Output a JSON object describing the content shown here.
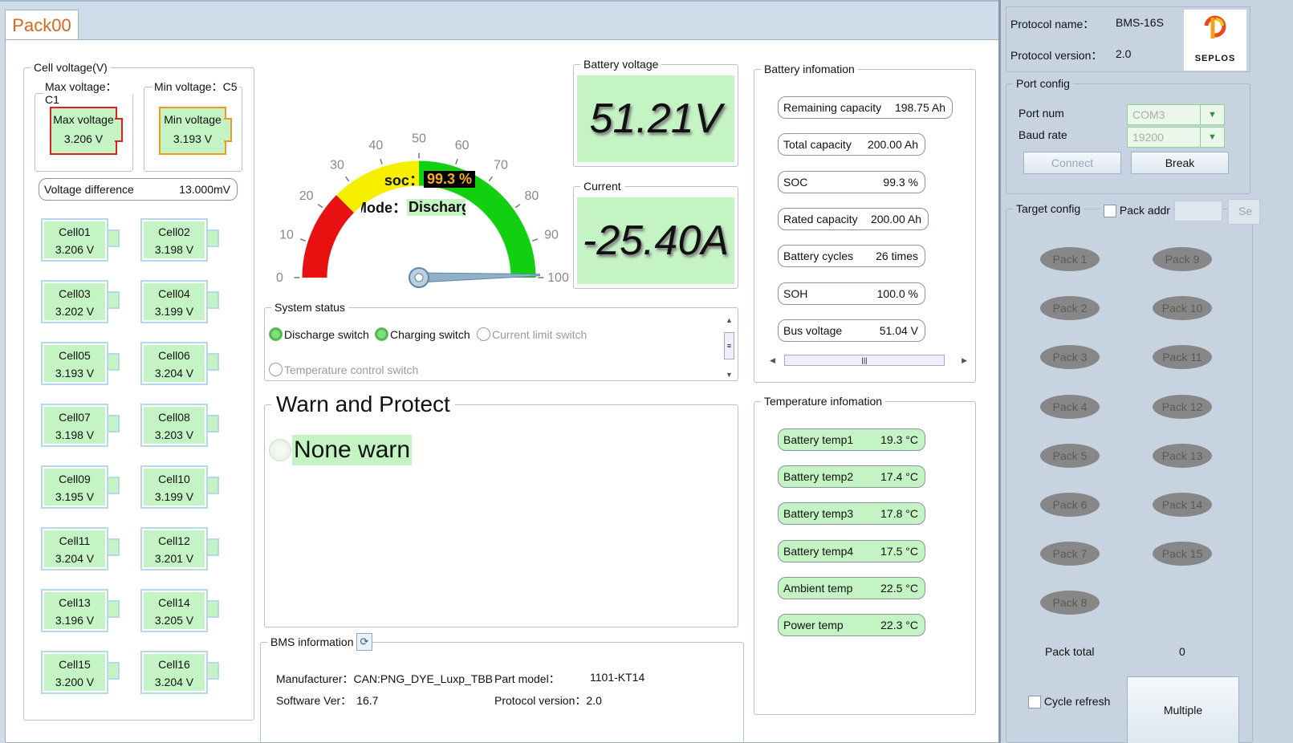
{
  "tab": {
    "label": "Pack00"
  },
  "cell_voltage": {
    "title": "Cell voltage(V)",
    "max_title": "Max voltage：C1",
    "min_title": "Min voltage：C5",
    "max_label": "Max voltage",
    "max_value": "3.206 V",
    "min_label": "Min voltage",
    "min_value": "3.193 V",
    "diff_label": "Voltage difference",
    "diff_value": "13.000mV",
    "cells": [
      {
        "name": "Cell01",
        "value": "3.206 V"
      },
      {
        "name": "Cell02",
        "value": "3.198 V"
      },
      {
        "name": "Cell03",
        "value": "3.202 V"
      },
      {
        "name": "Cell04",
        "value": "3.199 V"
      },
      {
        "name": "Cell05",
        "value": "3.193 V"
      },
      {
        "name": "Cell06",
        "value": "3.204 V"
      },
      {
        "name": "Cell07",
        "value": "3.198 V"
      },
      {
        "name": "Cell08",
        "value": "3.203 V"
      },
      {
        "name": "Cell09",
        "value": "3.195 V"
      },
      {
        "name": "Cell10",
        "value": "3.199 V"
      },
      {
        "name": "Cell11",
        "value": "3.204 V"
      },
      {
        "name": "Cell12",
        "value": "3.201 V"
      },
      {
        "name": "Cell13",
        "value": "3.196 V"
      },
      {
        "name": "Cell14",
        "value": "3.205 V"
      },
      {
        "name": "Cell15",
        "value": "3.200 V"
      },
      {
        "name": "Cell16",
        "value": "3.204 V"
      }
    ]
  },
  "gauge": {
    "ticks": [
      "0",
      "10",
      "20",
      "30",
      "40",
      "50",
      "60",
      "70",
      "80",
      "90",
      "100"
    ],
    "soc_label": "soc：",
    "soc_value": "99.3 %",
    "soc_fraction": 0.993,
    "mode_label": "Mode：",
    "mode_value": "Discharge",
    "colors": {
      "red": "#e81010",
      "yellow": "#f6f000",
      "green": "#10d010"
    }
  },
  "battery_voltage": {
    "title": "Battery voltage",
    "value": "51.21V"
  },
  "current": {
    "title": "Current",
    "value": "-25.40A"
  },
  "system_status": {
    "title": "System status",
    "items": [
      {
        "label": "Discharge switch",
        "on": true
      },
      {
        "label": "Charging switch",
        "on": true
      },
      {
        "label": "Current limit switch",
        "on": false
      },
      {
        "label": "Temperature control switch",
        "on": false
      }
    ]
  },
  "warn": {
    "title": "Warn and Protect",
    "status": "None warn"
  },
  "bms_info": {
    "title": "BMS information",
    "manufacturer_label": "Manufacturer：",
    "manufacturer": "CAN:PNG_DYE_Luxp_TBB",
    "model_label": "Part model：",
    "model": "1101-KT14",
    "software_label": "Software Ver：",
    "software": "16.7",
    "protocol_label": "Protocol version：",
    "protocol": "2.0"
  },
  "battery_info": {
    "title": "Battery infomation",
    "rows": [
      {
        "label": "Remaining capacity",
        "value": "198.75 Ah"
      },
      {
        "label": "Total capacity",
        "value": "200.00 Ah"
      },
      {
        "label": "SOC",
        "value": "99.3 %"
      },
      {
        "label": "Rated capacity",
        "value": "200.00 Ah"
      },
      {
        "label": "Battery cycles",
        "value": "26 times"
      },
      {
        "label": "SOH",
        "value": "100.0 %"
      },
      {
        "label": "Bus voltage",
        "value": "51.04 V"
      }
    ]
  },
  "temperature_info": {
    "title": "Temperature infomation",
    "rows": [
      {
        "label": "Battery temp1",
        "value": "19.3 °C"
      },
      {
        "label": "Battery temp2",
        "value": "17.4 °C"
      },
      {
        "label": "Battery temp3",
        "value": "17.8 °C"
      },
      {
        "label": "Battery temp4",
        "value": "17.5 °C"
      },
      {
        "label": "Ambient temp",
        "value": "22.5 °C"
      },
      {
        "label": "Power temp",
        "value": "22.3 °C"
      }
    ]
  },
  "protocol": {
    "name_label": "Protocol name：",
    "name": "BMS-16S",
    "version_label": "Protocol version：",
    "version": "2.0",
    "logo_text": "SEPLOS"
  },
  "port_config": {
    "title": "Port config",
    "port_label": "Port num",
    "port": "COM3",
    "baud_label": "Baud rate",
    "baud": "19200",
    "connect": "Connect",
    "break": "Break"
  },
  "target_config": {
    "title": "Target config",
    "pack_addr": "Pack addr",
    "set_partial": "Se",
    "packs": [
      "Pack 1",
      "Pack 2",
      "Pack 3",
      "Pack 4",
      "Pack 5",
      "Pack 6",
      "Pack 7",
      "Pack 8",
      "Pack 9",
      "Pack 10",
      "Pack 11",
      "Pack 12",
      "Pack 13",
      "Pack 14",
      "Pack 15"
    ],
    "total_label": "Pack total",
    "total": "0",
    "cycle_refresh": "Cycle refresh",
    "multiple": "Multiple"
  }
}
